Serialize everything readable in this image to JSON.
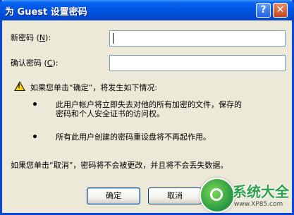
{
  "dialog": {
    "title": "为 Guest 设置密码",
    "help_button": "?",
    "close_button": "✕"
  },
  "fields": {
    "new_password_label_pre": "新密码 (",
    "new_password_accel": "N",
    "new_password_label_post": "):",
    "new_password_value": "",
    "confirm_password_label_pre": "确认密码 (",
    "confirm_password_accel": "C",
    "confirm_password_label_post": "):",
    "confirm_password_value": ""
  },
  "message": {
    "warning_icon": "warning-icon",
    "intro": "如果您单击“确定”，将发生如下情况:",
    "bullet1_line1": "此用户帐户将立即失去对他的所有加密的文件，保存的",
    "bullet1_line2": "密码和个人安全证书的访问权。",
    "bullet2": "所有此用户创建的密码重设盘将不再起作用。",
    "cancel_note": "如果您单击“取消”，密码将不会被更改，并且将不会丢失数据。"
  },
  "buttons": {
    "ok": "确定",
    "cancel": "取消"
  },
  "watermark": {
    "title": "系统大全",
    "url": "www.XP85.com"
  }
}
